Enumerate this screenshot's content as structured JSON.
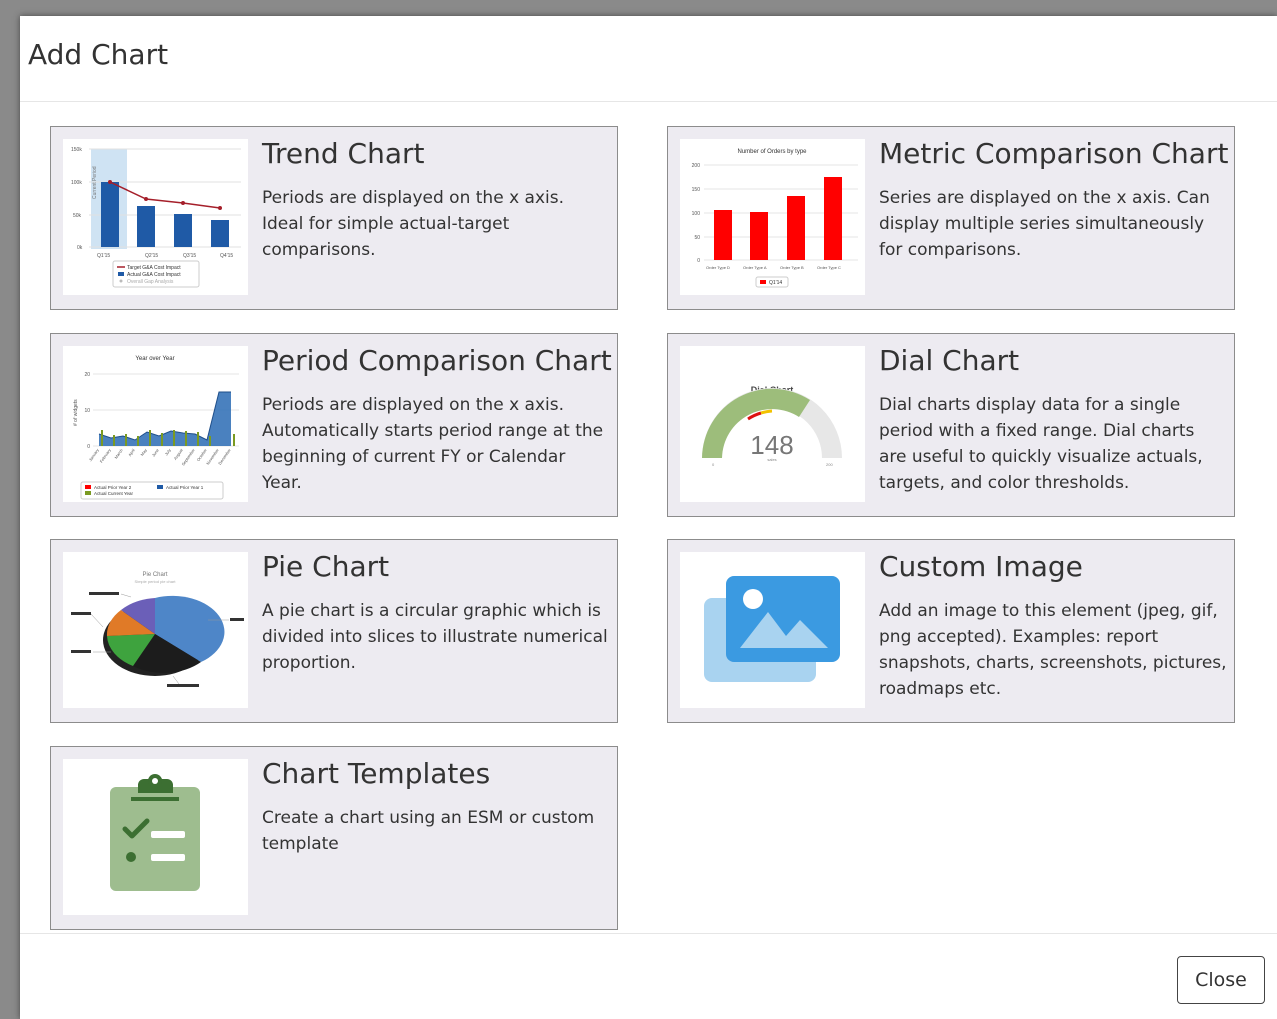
{
  "dialog": {
    "title": "Add Chart",
    "close_label": "Close"
  },
  "cards": [
    {
      "title": "Trend Chart",
      "description": "Periods are displayed on the x axis. Ideal for simple actual-target comparisons.",
      "thumbnail": {
        "y_ticks": [
          "150k",
          "100k",
          "50k",
          "0k"
        ],
        "x_ticks": [
          "Q1'15",
          "Q2'15",
          "Q3'15",
          "Q4'15"
        ],
        "y_axis_label": "Current Period",
        "legend": [
          "Target G&A Cost Impact",
          "Actual G&A Cost Impact",
          "Overall Gap Analysis"
        ]
      }
    },
    {
      "title": "Metric Comparison Chart",
      "description": "Series are displayed on the x axis. Can display multiple series simultaneously for comparisons.",
      "thumbnail": {
        "title": "Number of Orders by type",
        "y_ticks": [
          "200",
          "150",
          "100",
          "50",
          "0"
        ],
        "x_ticks": [
          "Order Type D",
          "Order Type A",
          "Order Type B",
          "Order Type C"
        ],
        "legend": [
          "Q1'14"
        ]
      }
    },
    {
      "title": "Period Comparison Chart",
      "description": "Periods are displayed on the x axis. Automatically starts period range at the beginning of current FY or Calendar Year.",
      "thumbnail": {
        "title": "Year over Year",
        "y_ticks": [
          "20",
          "10",
          "0"
        ],
        "y_axis_label": "# of widgets",
        "x_ticks": [
          "January",
          "February",
          "March",
          "April",
          "May",
          "June",
          "July",
          "August",
          "September",
          "October",
          "November",
          "December"
        ],
        "legend": [
          "Actual Prior Year 2",
          "Actual Prior Year 1",
          "Actual Current Year"
        ]
      }
    },
    {
      "title": "Dial Chart",
      "description": "Dial charts display data for a single period with a fixed range. Dial charts are useful to quickly visualize actuals, targets, and color thresholds.",
      "thumbnail": {
        "title": "Dial Chart",
        "value": "148",
        "unit": "sales",
        "min": "0",
        "max": "200"
      }
    },
    {
      "title": "Pie Chart",
      "description": "A pie chart is a circular graphic which is divided into slices to illustrate numerical proportion.",
      "thumbnail": {
        "title": "Pie Chart",
        "subtitle": "Simple period pie chart"
      }
    },
    {
      "title": "Custom Image",
      "description": "Add an image to this element (jpeg, gif, png accepted). Examples: report snapshots, charts, screenshots, pictures, roadmaps etc."
    },
    {
      "title": "Chart Templates",
      "description": "Create a chart using an ESM or custom template"
    }
  ],
  "colors": {
    "card_bg": "#edebf1",
    "trend_blue": "#1f5aa6",
    "metric_red": "#ff0000",
    "template_green": "#9ebd8f",
    "template_dark_green": "#3c6f32",
    "image_blue": "#3b9ae1",
    "image_light_blue": "#a9d3f0"
  }
}
